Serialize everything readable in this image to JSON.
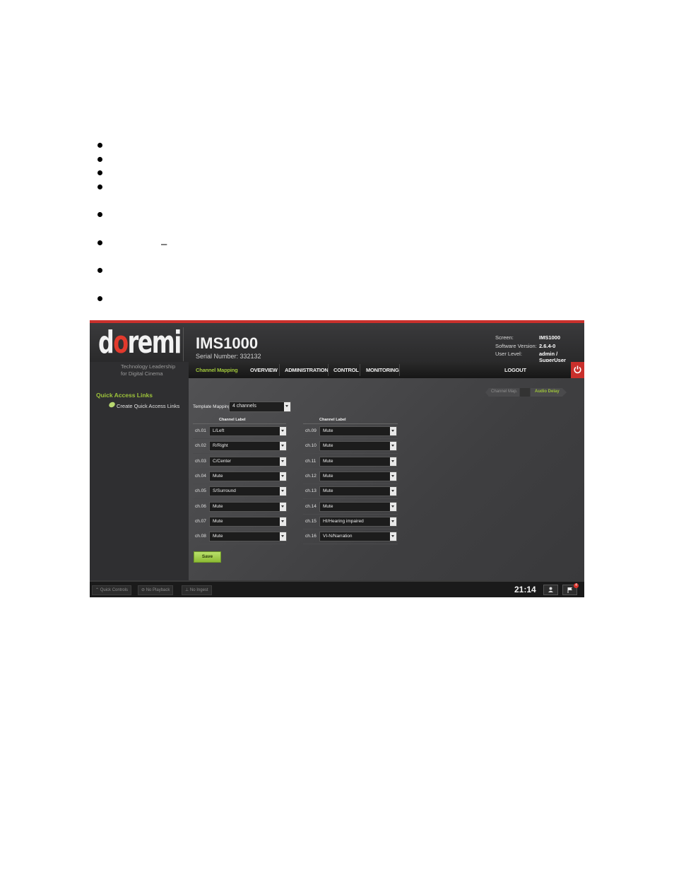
{
  "document": {
    "dash": "–"
  },
  "app": {
    "logo": "doremi",
    "tagline_line1": "Technology Leadership",
    "tagline_line2": "for Digital Cinema",
    "device_name": "IMS1000",
    "serial": "Serial Number: 332132",
    "info": [
      {
        "label": "Screen:",
        "value": "IMS1000"
      },
      {
        "label": "Software Version:",
        "value": "2.6.4-0"
      },
      {
        "label": "User Level:",
        "value": "admin / SuperUser"
      }
    ],
    "sidebar": {
      "title": "Quick Access Links",
      "link": "Create Quick Access Links"
    },
    "nav": {
      "active": "Channel Mapping",
      "items": [
        "OVERVIEW",
        "ADMINISTRATION",
        "CONTROL",
        "MONITORING"
      ],
      "logout": "LOGOUT"
    },
    "toggle": {
      "left": "Channel Map.",
      "right": "Audio Delay"
    },
    "template_mapping": {
      "label": "Template Mapping:",
      "value": "4 channels"
    },
    "column_header": "Channel Label",
    "channels": [
      {
        "ch": "ch.01",
        "value": "L/Left"
      },
      {
        "ch": "ch.02",
        "value": "R/Right"
      },
      {
        "ch": "ch.03",
        "value": "C/Center"
      },
      {
        "ch": "ch.04",
        "value": "Mute"
      },
      {
        "ch": "ch.05",
        "value": "S/Surround"
      },
      {
        "ch": "ch.06",
        "value": "Mute"
      },
      {
        "ch": "ch.07",
        "value": "Mute"
      },
      {
        "ch": "ch.08",
        "value": "Mute"
      },
      {
        "ch": "ch.09",
        "value": "Mute"
      },
      {
        "ch": "ch.10",
        "value": "Mute"
      },
      {
        "ch": "ch.11",
        "value": "Mute"
      },
      {
        "ch": "ch.12",
        "value": "Mute"
      },
      {
        "ch": "ch.13",
        "value": "Mute"
      },
      {
        "ch": "ch.14",
        "value": "Mute"
      },
      {
        "ch": "ch.15",
        "value": "HI/Hearing impaired"
      },
      {
        "ch": "ch.16",
        "value": "VI-N/Narration"
      }
    ],
    "save_label": "Save",
    "footer": {
      "quick_controls": "Quick Controls",
      "playback": "No Playback",
      "ingest": "No Ingest",
      "clock": "21:14",
      "badge": "4"
    },
    "colors": {
      "accent_green": "#9ec43a",
      "brand_red": "#c9302c"
    }
  }
}
